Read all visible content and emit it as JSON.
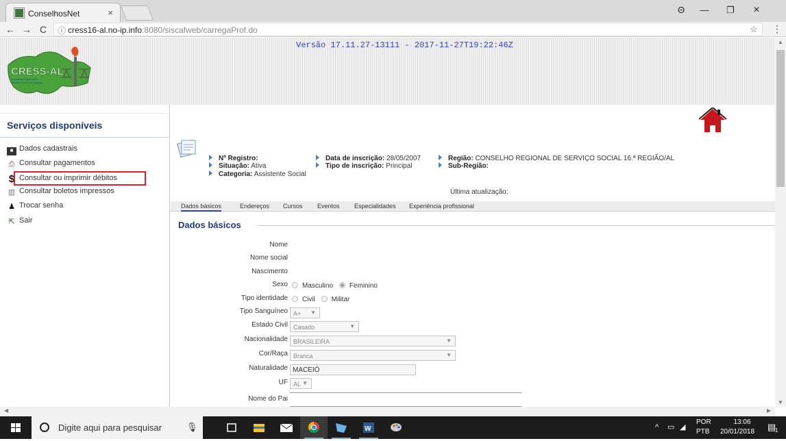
{
  "browser": {
    "tab_title": "ConselhosNet",
    "tab_close": "×",
    "url_host": "cress16-al.no-ip.info",
    "url_rest": ":8080/siscafweb/carregaProf.do",
    "back": "←",
    "forward": "→",
    "reload": "C",
    "info": "ⓘ",
    "star": "☆",
    "menu": "⋮",
    "account": "Θ",
    "minimize": "—",
    "restore": "❐",
    "close": "×"
  },
  "header": {
    "version": "Versão 17.11.27-13111 - 2017-11-27T19:22:46Z",
    "logo_text": "CRESS-AL",
    "logo_sub1": "Conselho Regional de",
    "logo_sub2": "Serviço Social de Alagoas"
  },
  "sidebar": {
    "title": "Serviços disponíveis",
    "items": [
      {
        "label": "Dados cadastrais",
        "icon": "id-card-icon"
      },
      {
        "label": "Consultar pagamentos",
        "icon": "printer-icon"
      },
      {
        "label": "Consultar ou imprimir débitos",
        "icon": "dollar-icon"
      },
      {
        "label": "Consultar boletos impressos",
        "icon": "boleto-icon"
      },
      {
        "label": "Trocar senha",
        "icon": "user-key-icon"
      },
      {
        "label": "Sair",
        "icon": "exit-icon"
      }
    ]
  },
  "profile": {
    "registro_label": "Nº Registro:",
    "registro_value": "",
    "situacao_label": "Situação:",
    "situacao_value": "Ativa",
    "categoria_label": "Categoria:",
    "categoria_value": "Assistente Social",
    "inscricao_label": "Data de inscrição:",
    "inscricao_value": "28/05/2007",
    "tipo_label": "Tipo de inscrição:",
    "tipo_value": "Principal",
    "regiao_label": "Região:",
    "regiao_value": "CONSELHO REGIONAL DE SERVIÇO SOCIAL 16.ª REGIÃO/AL",
    "subregiao_label": "Sub-Região:",
    "subregiao_value": "",
    "ultima_atualizacao": "Última atualização:"
  },
  "tabs": [
    "Dados básicos",
    "Endereços",
    "Cursos",
    "Eventos",
    "Especialidades",
    "Experiência profissional"
  ],
  "form": {
    "section_title": "Dados básicos",
    "nome_label": "Nome",
    "nome_social_label": "Nome social",
    "nascimento_label": "Nascimento",
    "sexo_label": "Sexo",
    "sexo_options": [
      "Masculino",
      "Feminino"
    ],
    "sexo_selected": "Feminino",
    "tipo_identidade_label": "Tipo identidade",
    "tipo_identidade_options": [
      "Civil",
      "Militar"
    ],
    "tipo_sanguineo_label": "Tipo Sanguíneo",
    "tipo_sanguineo_value": "A+",
    "estado_civil_label": "Estado Civil",
    "estado_civil_value": "Casado",
    "nacionalidade_label": "Nacionalidade",
    "nacionalidade_value": "BRASILEIRA",
    "cor_raca_label": "Cor/Raça",
    "cor_raca_value": "Branca",
    "naturalidade_label": "Naturalidade",
    "naturalidade_value": "MACEIÓ",
    "uf_label": "UF",
    "uf_value": "AL",
    "nome_pai_label": "Nome do Pai",
    "dropdown_arrow": "▼"
  },
  "taskbar": {
    "search_placeholder": "Digite aqui para pesquisar",
    "lang1": "POR",
    "lang2": "PTB",
    "time": "13:06",
    "date": "20/01/2018",
    "tray_up": "^",
    "notification_count": "1"
  },
  "colors": {
    "accent_blue": "#1f3a7a",
    "version_blue": "#2f3fd6",
    "highlight_red": "#e0202a",
    "logo_green": "#4aa33a"
  }
}
